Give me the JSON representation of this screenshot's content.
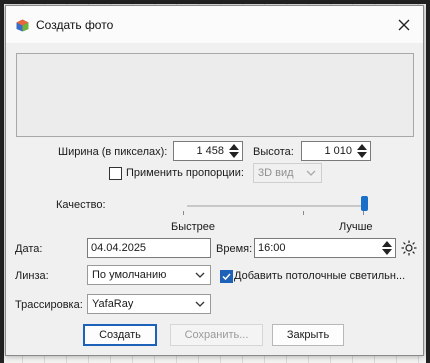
{
  "window": {
    "title": "Создать фото"
  },
  "size": {
    "width_label": "Ширина (в пикселах):",
    "width_value": "1 458",
    "height_label": "Высота:",
    "height_value": "1 010",
    "keep_proportions_label": "Применить пропорции:",
    "keep_proportions_checked": false,
    "view_combo_value": "3D вид"
  },
  "quality": {
    "label": "Качество:",
    "faster_label": "Быстрее",
    "better_label": "Лучше",
    "level": 1.0
  },
  "date": {
    "label": "Дата:",
    "value": "04.04.2025"
  },
  "time": {
    "label": "Время:",
    "value": "16:00"
  },
  "lens": {
    "label": "Линза:",
    "value": "По умолчанию"
  },
  "ceiling_lights": {
    "label": "Добавить потолочные светильн...",
    "checked": true
  },
  "renderer": {
    "label": "Трассировка:",
    "value": "YafaRay"
  },
  "buttons": {
    "create": "Создать",
    "save": "Сохранить...",
    "close": "Закрыть"
  },
  "colors": {
    "accent": "#1e61b8",
    "slider_thumb": "#1a6fc9"
  },
  "icons": {
    "app": "sweet-home-3d-icon",
    "close": "close-icon",
    "sun": "sun-icon"
  }
}
